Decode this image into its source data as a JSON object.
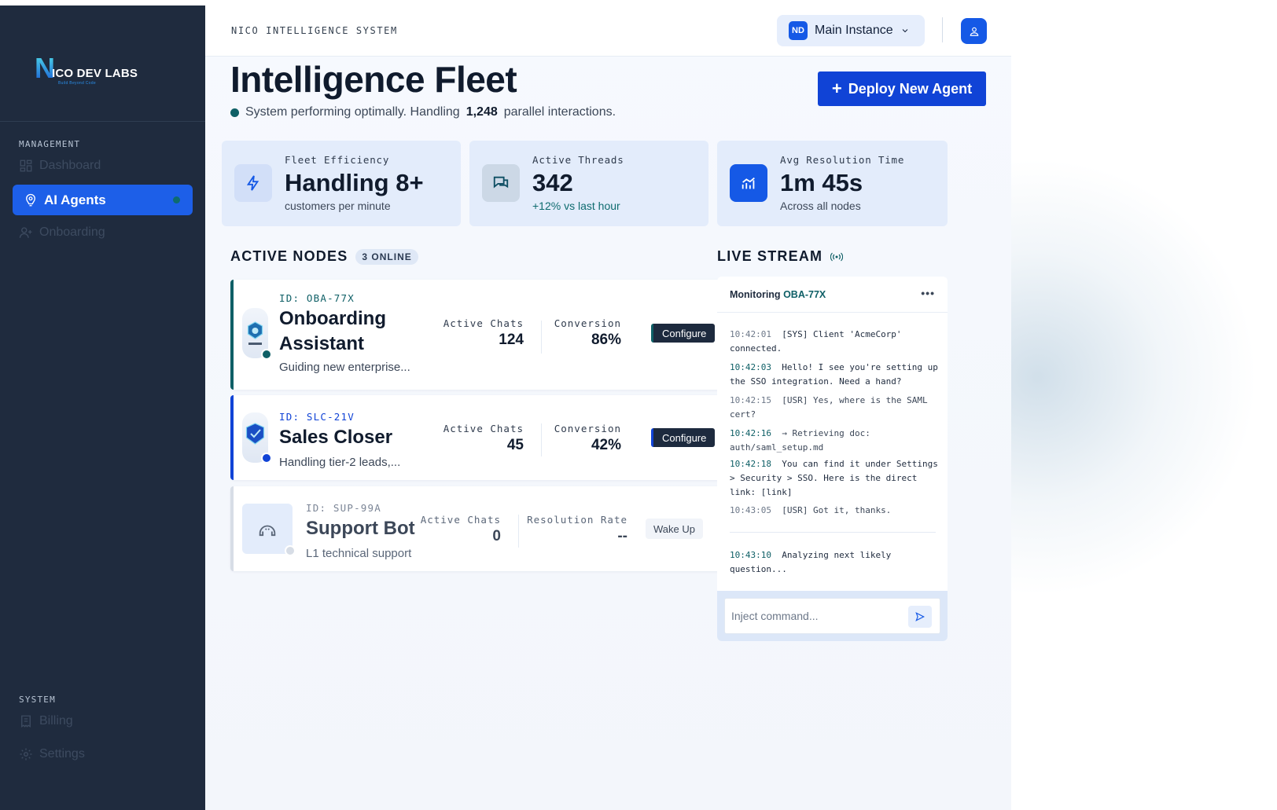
{
  "sidebar": {
    "logo": {
      "initial": "N",
      "text": "ICO DEV LABS",
      "tagline": "Build Beyond Code"
    },
    "management_label": "MANAGEMENT",
    "items": [
      {
        "label": "Dashboard",
        "icon": "dashboard-icon"
      },
      {
        "label": "AI Agents",
        "icon": "agent-icon"
      },
      {
        "label": "Onboarding",
        "icon": "user-plus-icon"
      }
    ],
    "system_label": "SYSTEM",
    "system_items": [
      {
        "label": "Billing",
        "icon": "receipt-icon"
      },
      {
        "label": "Settings",
        "icon": "gear-icon"
      }
    ]
  },
  "topbar": {
    "system_name": "NICO INTELLIGENCE SYSTEM",
    "instance_badge": "ND",
    "instance_label": "Main Instance"
  },
  "header": {
    "title": "Intelligence Fleet",
    "status_pre": "System performing optimally. Handling",
    "status_count": "1,248",
    "status_post": "parallel interactions.",
    "deploy_label": "Deploy New Agent"
  },
  "stats": [
    {
      "label": "Fleet Efficiency",
      "value": "Handling 8+",
      "sub": "customers per minute",
      "icon": "lightning-icon"
    },
    {
      "label": "Active Threads",
      "value": "342",
      "sub": "+12% vs last hour",
      "icon": "chat-icon"
    },
    {
      "label": "Avg Resolution Time",
      "value": "1m 45s",
      "sub": "Across all nodes",
      "icon": "chart-icon"
    }
  ],
  "active_nodes": {
    "title": "ACTIVE NODES",
    "badge": "3 ONLINE",
    "nodes": [
      {
        "id": "ID: OBA-77X",
        "name_line1": "Onboarding",
        "name_line2": "Assistant",
        "desc": "Guiding new enterprise...",
        "m1_label": "Active Chats",
        "m1_value": "124",
        "m2_label": "Conversion",
        "m2_value": "86%",
        "action": "Configure"
      },
      {
        "id": "ID: SLC-21V",
        "name_line1": "Sales Closer",
        "desc": "Handling tier-2 leads,...",
        "m1_label": "Active Chats",
        "m1_value": "45",
        "m2_label": "Conversion",
        "m2_value": "42%",
        "action": "Configure"
      },
      {
        "id": "ID: SUP-99A",
        "name_line1": "Support Bot",
        "desc": "L1 technical support",
        "m1_label": "Active Chats",
        "m1_value": "0",
        "m2_label": "Resolution Rate",
        "m2_value": "--",
        "action": "Wake Up"
      }
    ]
  },
  "live_stream": {
    "title": "LIVE STREAM",
    "monitoring_label": "Monitoring",
    "monitoring_id": "OBA-77X",
    "logs": [
      {
        "time": "10:42:01",
        "text": "[SYS] Client 'AcmeCorp' connected."
      },
      {
        "time": "10:42:03",
        "text": "Hello! I see you're setting up the SSO integration. Need a hand?"
      },
      {
        "time": "10:42:15",
        "text": "[USR] Yes, where is the SAML cert?"
      },
      {
        "time": "10:42:16",
        "text": "→ Retrieving doc: auth/saml_setup.md"
      },
      {
        "time": "10:42:18",
        "text": "You can find it under Settings > Security > SSO. Here is the direct link: [link]"
      },
      {
        "time": "10:43:05",
        "text": "[USR] Got it, thanks."
      },
      {
        "time": "10:43:10",
        "text": "Analyzing next likely question..."
      }
    ],
    "input_placeholder": "Inject command..."
  }
}
